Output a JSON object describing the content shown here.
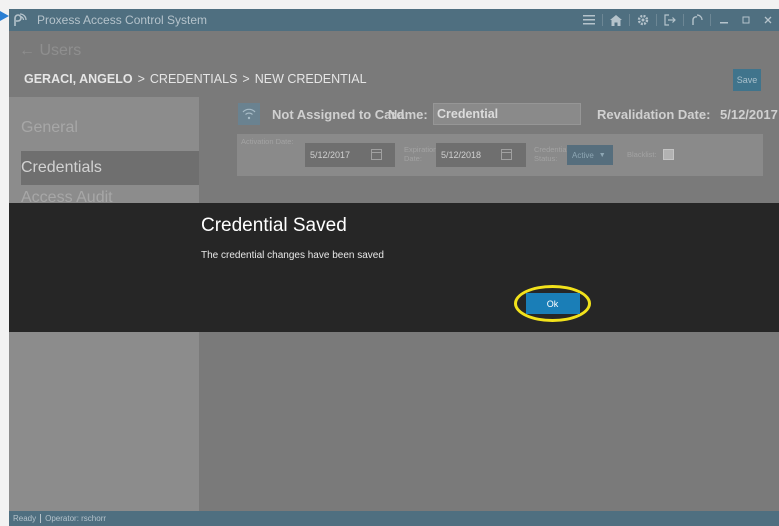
{
  "window": {
    "title": "Proxess Access Control System"
  },
  "header": {
    "back_label": "← Users",
    "breadcrumb": {
      "person": "GERACI, ANGELO",
      "sep": ">",
      "section": "CREDENTIALS",
      "current": "NEW CREDENTIAL"
    },
    "save_label": "Save"
  },
  "sidebar": {
    "items": [
      {
        "label": "General"
      },
      {
        "label": "Credentials"
      },
      {
        "label": "Access Audit"
      }
    ]
  },
  "credential": {
    "card_status": "Not Assigned to Card",
    "name_label": "Name:",
    "name_value": "Credential",
    "revalidation_label": "Revalidation Date:",
    "revalidation_value": "5/12/2017",
    "activation_label": "Activation Date:",
    "activation_value": "5/12/2017",
    "expiration_label": "Expiration Date:",
    "expiration_value": "5/12/2018",
    "status_label": "Credential Status:",
    "status_value": "Active",
    "blacklist_label": "Blacklist:"
  },
  "modal": {
    "title": "Credential Saved",
    "message": "The credential changes have been saved",
    "ok_label": "Ok"
  },
  "statusbar": {
    "state": "Ready",
    "operator": "Operator: rschorr"
  },
  "colors": {
    "titlebar": "#4f6f80",
    "modal_bg": "#262626",
    "ok_button": "#1a7eb7",
    "highlight_ring": "#f2e21b"
  }
}
